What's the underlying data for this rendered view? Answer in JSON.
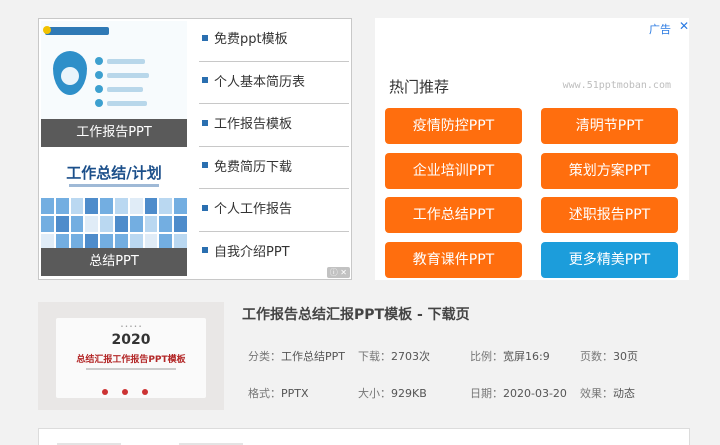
{
  "left_ad": {
    "thumb1_caption": "工作报告PPT",
    "thumb2_caption": "总结PPT",
    "thumb2_title": "工作总结/计划",
    "links": [
      "免费ppt模板",
      "个人基本简历表",
      "工作报告模板",
      "免费简历下载",
      "个人工作报告",
      "自我介绍PPT"
    ]
  },
  "right_ad": {
    "ad_label": "广告",
    "close": "✕",
    "title": "热门推荐",
    "watermark": "www.51pptmoban.com",
    "buttons": [
      {
        "label": "疫情防控PPT"
      },
      {
        "label": "清明节PPT"
      },
      {
        "label": "企业培训PPT"
      },
      {
        "label": "策划方案PPT"
      },
      {
        "label": "工作总结PPT"
      },
      {
        "label": "述职报告PPT"
      },
      {
        "label": "教育课件PPT"
      },
      {
        "label": "更多精美PPT"
      }
    ],
    "colors": {
      "orange": "#ff6e0e",
      "blue": "#1c9ddb"
    }
  },
  "product": {
    "card_year": "2020",
    "card_title": "总结汇报工作报告PPT模板",
    "title": "工作报告总结汇报PPT模板 - 下载页",
    "category_label": "分类：",
    "category": "工作总结PPT",
    "downloads_label": "下载：",
    "downloads": "2703次",
    "ratio_label": "比例：",
    "ratio": "宽屏16:9",
    "pages_label": "页数：",
    "pages": "30页",
    "format_label": "格式：",
    "format": "PPTX",
    "size_label": "大小：",
    "size": "929KB",
    "date_label": "日期：",
    "date": "2020-03-20",
    "effect_label": "效果：",
    "effect": "动态"
  }
}
